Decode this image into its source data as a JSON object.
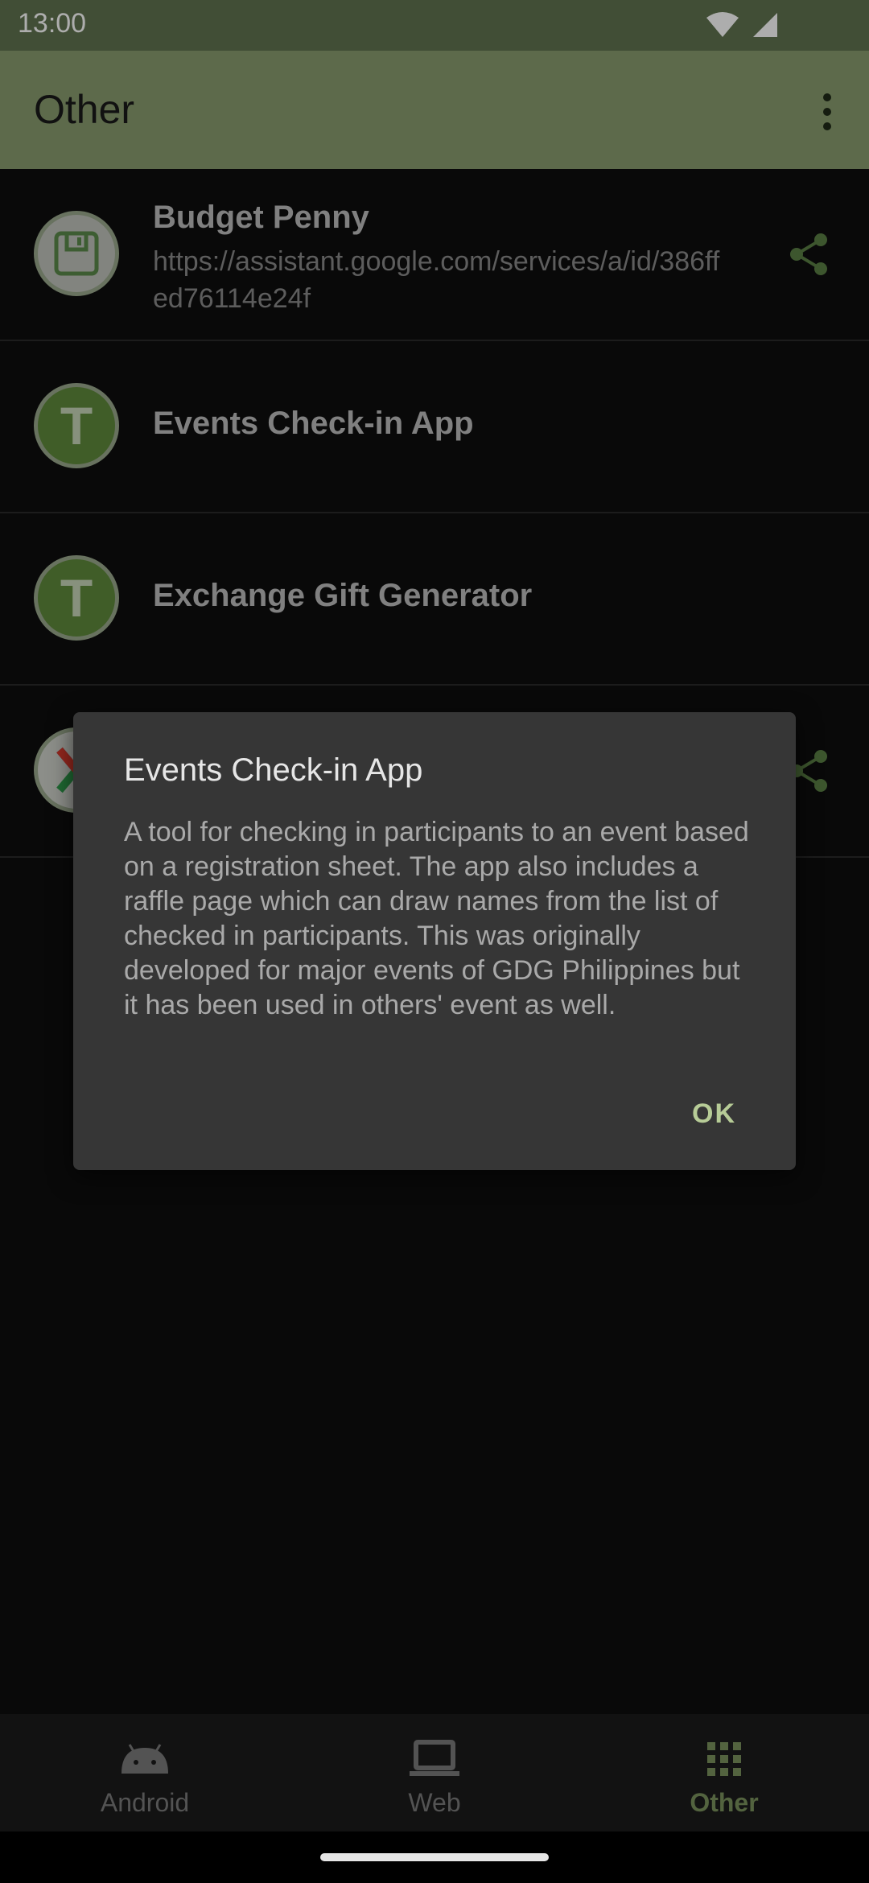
{
  "status_bar": {
    "time": "13:00"
  },
  "app_bar": {
    "title": "Other"
  },
  "items": [
    {
      "title": "Budget Penny",
      "subtitle": "https://assistant.google.com/services/a/id/386ffed76114e24f",
      "avatar_icon": "floppy-disk-icon"
    },
    {
      "title": "Events Check-in App",
      "avatar_letter": "T"
    },
    {
      "title": "Exchange Gift Generator",
      "avatar_letter": "T"
    },
    {
      "title": "",
      "avatar_icon": "x-logo-icon"
    }
  ],
  "dialog": {
    "title": "Events Check-in App",
    "body": "A tool for checking in participants to an event based on a registration sheet. The app also includes a raffle page which can draw names from the list of checked in participants. This was originally developed for major events of GDG Philippines but it has been used in others' event as well.",
    "ok_label": "OK"
  },
  "bottom_nav": {
    "items": [
      {
        "label": "Android",
        "icon": "android-icon"
      },
      {
        "label": "Web",
        "icon": "laptop-icon"
      },
      {
        "label": "Other",
        "icon": "grid-icon",
        "active": true
      }
    ]
  },
  "colors": {
    "status_bar": "#617450",
    "app_bar": "#8a9d6f",
    "accent": "#7b935e",
    "dialog_bg": "#363636",
    "ok_text": "#b7cc97"
  }
}
